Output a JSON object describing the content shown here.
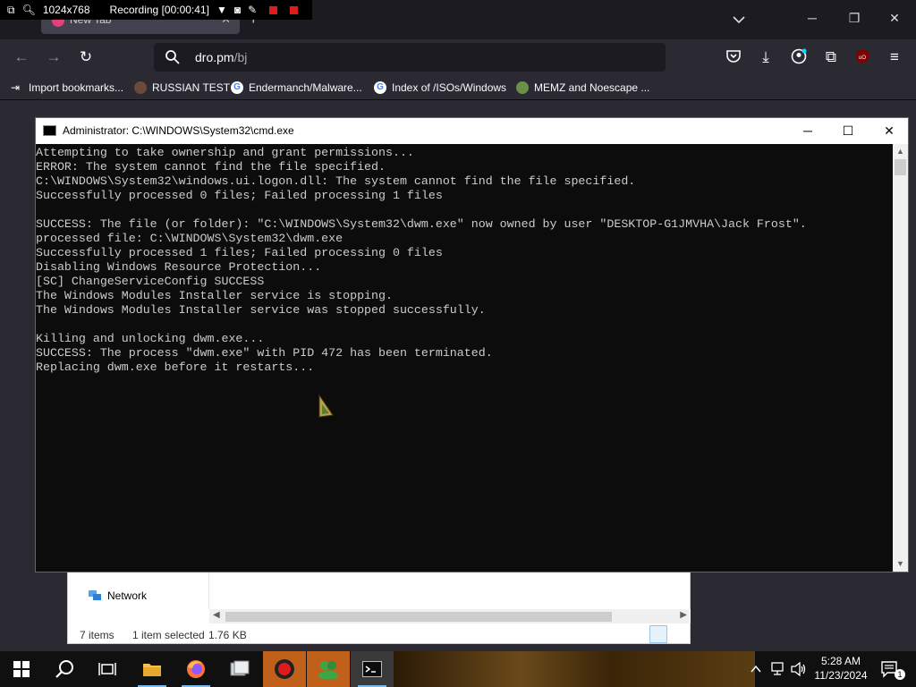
{
  "recorder": {
    "resolution": "1024x768",
    "status": "Recording [00:00:41]"
  },
  "browser": {
    "tab_title": "New Tab",
    "url_host": "dro.pm",
    "url_path": "/bj",
    "bookmarks": [
      {
        "label": "Import bookmarks...",
        "icon": "import-icon"
      },
      {
        "label": "RUSSIAN TEST",
        "icon": "magnifier-icon"
      },
      {
        "label": "Endermanch/Malware...",
        "icon": "google-icon"
      },
      {
        "label": "Index of /ISOs/Windows",
        "icon": "google-icon"
      },
      {
        "label": "MEMZ and Noescape ...",
        "icon": "memz-icon"
      }
    ],
    "accent_color": "#1c1b22"
  },
  "cmd": {
    "title": "Administrator: C:\\WINDOWS\\System32\\cmd.exe",
    "lines": [
      "Attempting to take ownership and grant permissions...",
      "ERROR: The system cannot find the file specified.",
      "C:\\WINDOWS\\System32\\windows.ui.logon.dll: The system cannot find the file specified.",
      "Successfully processed 0 files; Failed processing 1 files",
      "",
      "SUCCESS: The file (or folder): \"C:\\WINDOWS\\System32\\dwm.exe\" now owned by user \"DESKTOP-G1JMVHA\\Jack Frost\".",
      "processed file: C:\\WINDOWS\\System32\\dwm.exe",
      "Successfully processed 1 files; Failed processing 0 files",
      "Disabling Windows Resource Protection...",
      "[SC] ChangeServiceConfig SUCCESS",
      "The Windows Modules Installer service is stopping.",
      "The Windows Modules Installer service was stopped successfully.",
      "",
      "Killing and unlocking dwm.exe...",
      "SUCCESS: The process \"dwm.exe\" with PID 472 has been terminated.",
      "Replacing dwm.exe before it restarts..."
    ]
  },
  "explorer": {
    "nav_item": "Network",
    "items_count": "7 items",
    "selection": "1 item selected",
    "size": "1.76 KB"
  },
  "taskbar": {
    "time": "5:28 AM",
    "date": "11/23/2024",
    "notification_count": "1"
  }
}
